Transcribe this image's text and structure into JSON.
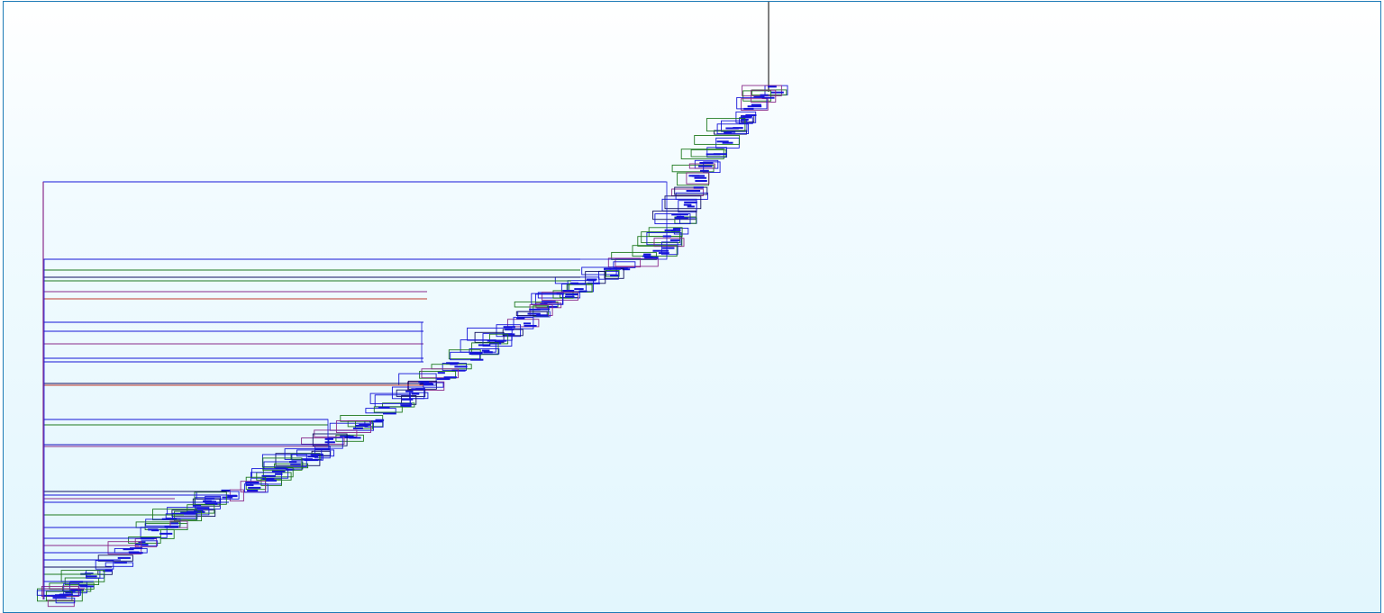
{
  "diagram": {
    "type": "dendrogram-tree",
    "colors": {
      "frame": "#1d7bb6",
      "background_top": "#ffffff",
      "background_bottom": "#e2f6fd",
      "trunk": "#555555",
      "blue": "#1515d8",
      "green": "#1f7a1f",
      "purple": "#8a2a8a",
      "red": "#c0392b",
      "dark": "#101060"
    }
  }
}
